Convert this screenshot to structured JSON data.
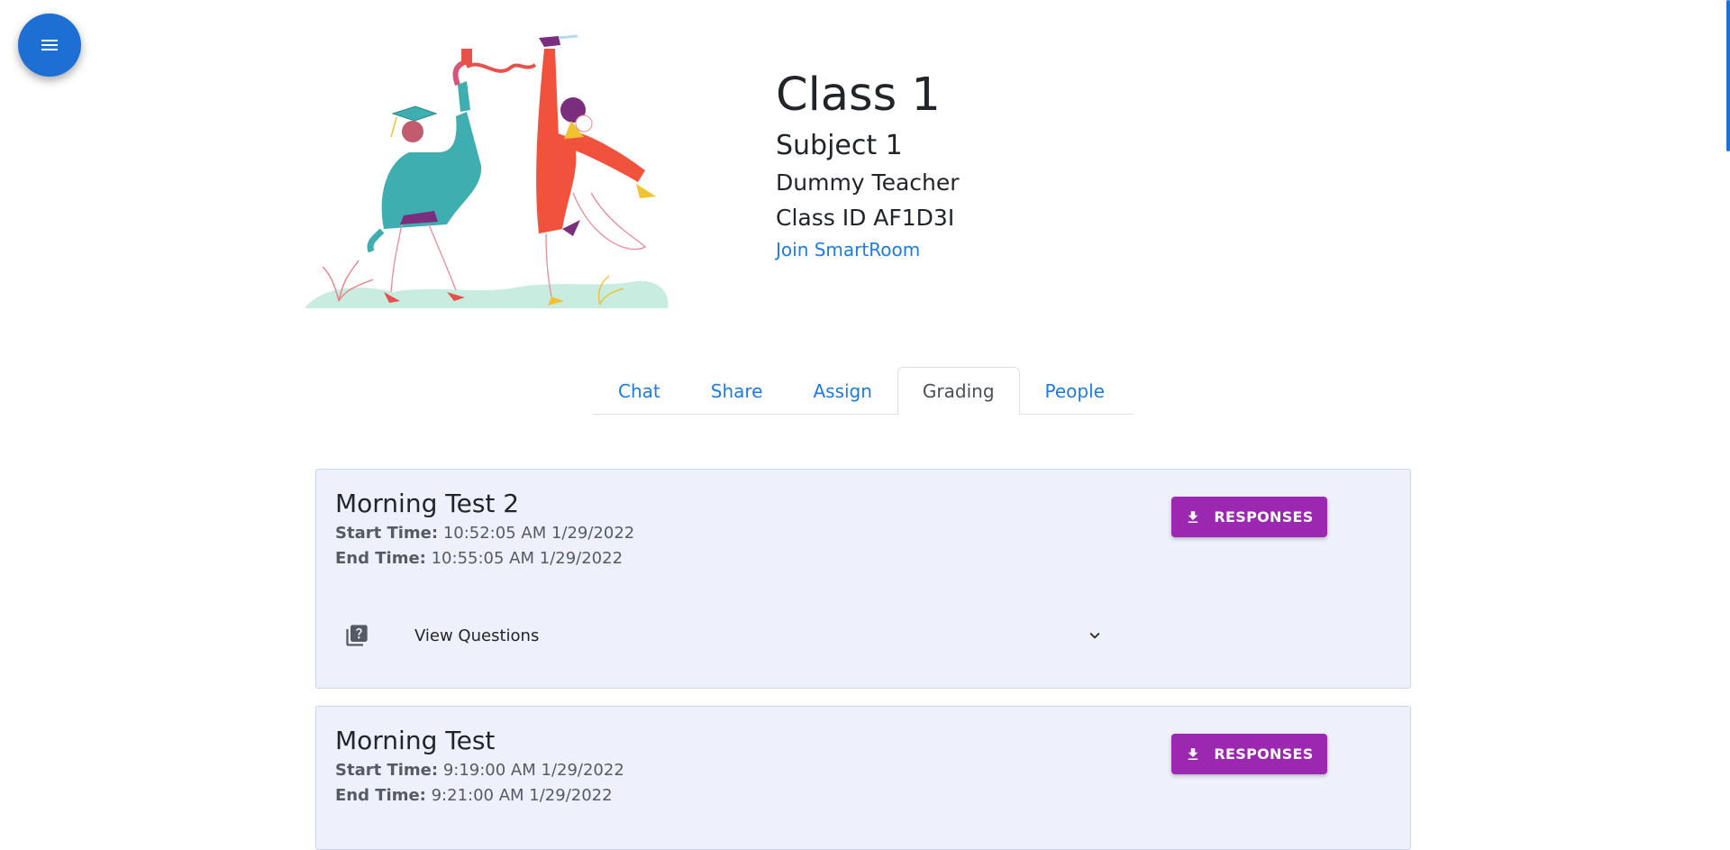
{
  "menu": {
    "icon": "menu-icon"
  },
  "header": {
    "illustration": "graduates-celebrating-illustration",
    "class_name": "Class 1",
    "subject": "Subject 1",
    "teacher": "Dummy Teacher",
    "class_id": "Class ID AF1D3I",
    "join_link": "Join SmartRoom"
  },
  "tabs": [
    {
      "label": "Chat",
      "active": false
    },
    {
      "label": "Share",
      "active": false
    },
    {
      "label": "Assign",
      "active": false
    },
    {
      "label": "Grading",
      "active": true
    },
    {
      "label": "People",
      "active": false
    }
  ],
  "tests": [
    {
      "title": "Morning Test 2",
      "start_label": "Start Time:",
      "start_value": "10:52:05 AM 1/29/2022",
      "end_label": "End Time:",
      "end_value": "10:55:05 AM 1/29/2022",
      "button_label": "RESPONSES",
      "button_icon": "download-icon",
      "questions_label": "View Questions",
      "questions_icon": "question-bank-icon"
    },
    {
      "title": "Morning Test",
      "start_label": "Start Time:",
      "start_value": "9:19:00 AM 1/29/2022",
      "end_label": "End Time:",
      "end_value": "9:21:00 AM 1/29/2022",
      "button_label": "RESPONSES",
      "button_icon": "download-icon"
    }
  ],
  "colors": {
    "primary": "#1e7be0",
    "fab": "#1e6fd4",
    "button": "#9c27b0",
    "card_bg": "#eef1fc"
  }
}
